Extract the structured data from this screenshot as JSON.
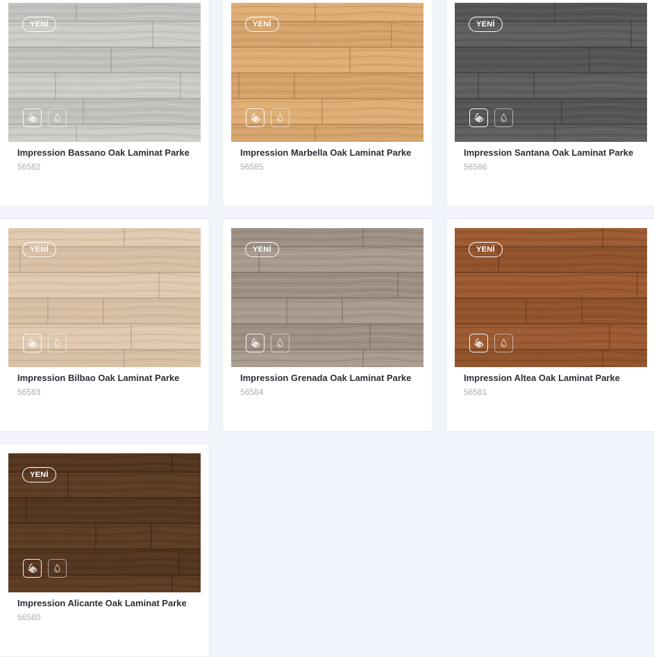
{
  "badge_label": "YENİ",
  "feature_icons": [
    "hand-touch-icon",
    "water-drop-icon"
  ],
  "products": [
    {
      "name": "Impression Bassano Oak Laminat Parke",
      "code": "56582",
      "color_base": "#c6c8c3",
      "color_line": "#8f918c",
      "color_grain": "#ecedea"
    },
    {
      "name": "Impression Marbella Oak Laminat Parke",
      "code": "56585",
      "color_base": "#dcab72",
      "color_line": "#9c6e3f",
      "color_grain": "#f0c995"
    },
    {
      "name": "Impression Santana Oak Laminat Parke",
      "code": "56586",
      "color_base": "#5b5c5b",
      "color_line": "#2f302f",
      "color_grain": "#7d7e7c"
    },
    {
      "name": "Impression Bilbao Oak Laminat Parke",
      "code": "56583",
      "color_base": "#dec6ab",
      "color_line": "#a48e77",
      "color_grain": "#efdfcb"
    },
    {
      "name": "Impression Grenada Oak Laminat Parke",
      "code": "56584",
      "color_base": "#a6978b",
      "color_line": "#6a5d53",
      "color_grain": "#c8bbb1"
    },
    {
      "name": "Impression Altea Oak Laminat Parke",
      "code": "56581",
      "color_base": "#99582f",
      "color_line": "#5a2f15",
      "color_grain": "#b8774a"
    },
    {
      "name": "Impression Alicante Oak Laminat Parke",
      "code": "56580",
      "color_base": "#5b3b23",
      "color_line": "#2e1c0f",
      "color_grain": "#7a5437"
    }
  ]
}
